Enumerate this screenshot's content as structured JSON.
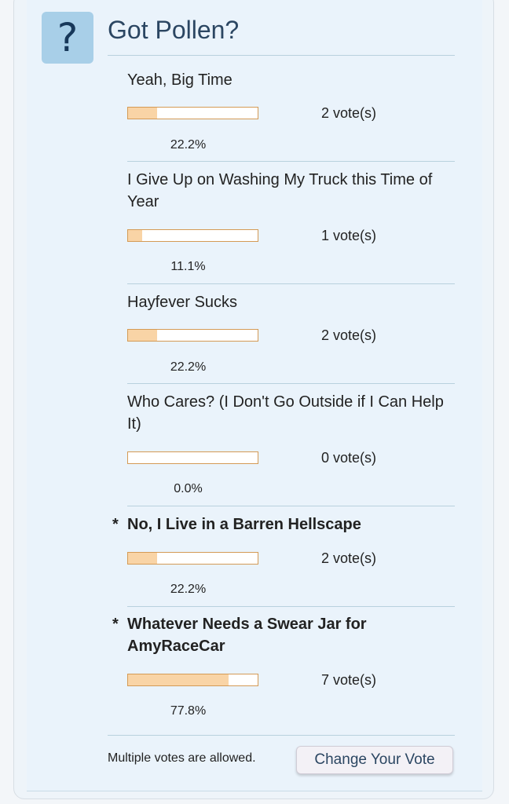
{
  "poll": {
    "icon": "?",
    "title": "Got Pollen?",
    "options": [
      {
        "label": "Yeah, Big Time",
        "votes": "2 vote(s)",
        "percent": "22.2%",
        "fraction": 0.222,
        "voted": false
      },
      {
        "label": "I Give Up on Washing My Truck this Time of Year",
        "votes": "1 vote(s)",
        "percent": "11.1%",
        "fraction": 0.111,
        "voted": false
      },
      {
        "label": "Hayfever Sucks",
        "votes": "2 vote(s)",
        "percent": "22.2%",
        "fraction": 0.222,
        "voted": false
      },
      {
        "label": "Who Cares? (I Don't Go Outside if I Can Help It)",
        "votes": "0 vote(s)",
        "percent": "0.0%",
        "fraction": 0.0,
        "voted": false
      },
      {
        "label": "No, I Live in a Barren Hellscape",
        "votes": "2 vote(s)",
        "percent": "22.2%",
        "fraction": 0.222,
        "voted": true
      },
      {
        "label": "Whatever Needs a Swear Jar for AmyRaceCar",
        "votes": "7 vote(s)",
        "percent": "77.8%",
        "fraction": 0.778,
        "voted": true
      }
    ],
    "voted_marker": "*",
    "footer_note": "Multiple votes are allowed.",
    "change_vote_label": "Change Your Vote"
  },
  "colors": {
    "bar_fill": "#f9d4a6",
    "bar_border": "#d49a55",
    "panel_bg": "#eaf3fb",
    "icon_bg": "#a8cfe8",
    "title_text": "#2b4662"
  }
}
